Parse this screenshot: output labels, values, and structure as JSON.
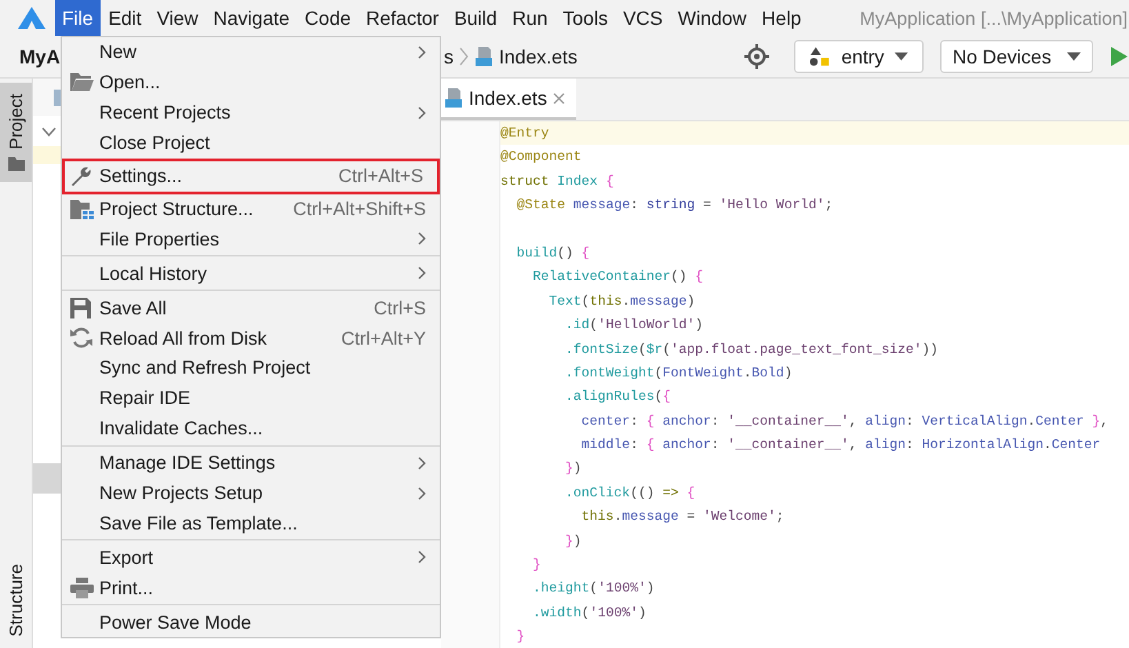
{
  "menubar": {
    "items": [
      {
        "label": "File",
        "selected": true
      },
      {
        "label": "Edit",
        "selected": false
      },
      {
        "label": "View",
        "selected": false
      },
      {
        "label": "Navigate",
        "selected": false
      },
      {
        "label": "Code",
        "selected": false
      },
      {
        "label": "Refactor",
        "selected": false
      },
      {
        "label": "Build",
        "selected": false
      },
      {
        "label": "Run",
        "selected": false
      },
      {
        "label": "Tools",
        "selected": false
      },
      {
        "label": "VCS",
        "selected": false
      },
      {
        "label": "Window",
        "selected": false
      },
      {
        "label": "Help",
        "selected": false
      }
    ],
    "title": "MyApplication [...\\MyApplication]"
  },
  "toolbar": {
    "project": "MyA",
    "breadcrumb": "s",
    "file": "Index.ets",
    "configuration": "entry",
    "device": "No Devices"
  },
  "side_tabs": [
    {
      "label": "Project",
      "selected": true,
      "kind": "top"
    },
    {
      "label": "Structure",
      "selected": false,
      "kind": "bottom"
    }
  ],
  "editor": {
    "tab": {
      "label": "Index.ets",
      "selected": true
    },
    "lines": [
      {
        "kind": "code",
        "current": true,
        "tokens": [
          {
            "text": "@Entry",
            "kind": "ann"
          }
        ]
      },
      {
        "kind": "code",
        "current": false,
        "tokens": [
          {
            "text": "@Component",
            "kind": "ann"
          }
        ]
      },
      {
        "kind": "code",
        "current": false,
        "tokens": [
          {
            "text": "struct ",
            "kind": "kw"
          },
          {
            "text": "Index ",
            "kind": "fn"
          },
          {
            "text": "{",
            "kind": "brace"
          }
        ]
      },
      {
        "kind": "code",
        "current": false,
        "tokens": [
          {
            "text": "  @State",
            "kind": "ann"
          },
          {
            "text": " message",
            "kind": "field"
          },
          {
            "text": ": ",
            "kind": "op"
          },
          {
            "text": "string",
            "kind": "type"
          },
          {
            "text": " = ",
            "kind": "op"
          },
          {
            "text": "'Hello World'",
            "kind": "str"
          },
          {
            "text": ";",
            "kind": "op"
          }
        ]
      },
      {
        "kind": "blank",
        "current": false
      },
      {
        "kind": "code",
        "current": false,
        "tokens": [
          {
            "text": "  build",
            "kind": "fn"
          },
          {
            "text": "() ",
            "kind": "op"
          },
          {
            "text": "{",
            "kind": "brace"
          }
        ]
      },
      {
        "kind": "code",
        "current": false,
        "tokens": [
          {
            "text": "    RelativeContainer",
            "kind": "fn"
          },
          {
            "text": "() ",
            "kind": "op"
          },
          {
            "text": "{",
            "kind": "brace"
          }
        ]
      },
      {
        "kind": "code",
        "current": false,
        "tokens": [
          {
            "text": "      Text",
            "kind": "fn"
          },
          {
            "text": "(",
            "kind": "op"
          },
          {
            "text": "this",
            "kind": "kw"
          },
          {
            "text": ".",
            "kind": "op"
          },
          {
            "text": "message",
            "kind": "field"
          },
          {
            "text": ")",
            "kind": "op"
          }
        ]
      },
      {
        "kind": "code",
        "current": false,
        "tokens": [
          {
            "text": "        .id",
            "kind": "fn"
          },
          {
            "text": "(",
            "kind": "op"
          },
          {
            "text": "'HelloWorld'",
            "kind": "str"
          },
          {
            "text": ")",
            "kind": "op"
          }
        ]
      },
      {
        "kind": "code",
        "current": false,
        "tokens": [
          {
            "text": "        .fontSize",
            "kind": "fn"
          },
          {
            "text": "(",
            "kind": "op"
          },
          {
            "text": "$r",
            "kind": "fn"
          },
          {
            "text": "(",
            "kind": "op"
          },
          {
            "text": "'app.float.page_text_font_size'",
            "kind": "str"
          },
          {
            "text": "))",
            "kind": "op"
          }
        ]
      },
      {
        "kind": "code",
        "current": false,
        "tokens": [
          {
            "text": "        .fontWeight",
            "kind": "fn"
          },
          {
            "text": "(",
            "kind": "op"
          },
          {
            "text": "FontWeight",
            "kind": "field"
          },
          {
            "text": ".",
            "kind": "op"
          },
          {
            "text": "Bold",
            "kind": "field"
          },
          {
            "text": ")",
            "kind": "op"
          }
        ]
      },
      {
        "kind": "code",
        "current": false,
        "tokens": [
          {
            "text": "        .alignRules",
            "kind": "fn"
          },
          {
            "text": "(",
            "kind": "op"
          },
          {
            "text": "{",
            "kind": "brace"
          }
        ]
      },
      {
        "kind": "code",
        "current": false,
        "tokens": [
          {
            "text": "          center",
            "kind": "field"
          },
          {
            "text": ": ",
            "kind": "op"
          },
          {
            "text": "{",
            "kind": "brace"
          },
          {
            "text": " anchor",
            "kind": "field"
          },
          {
            "text": ": ",
            "kind": "op"
          },
          {
            "text": "'__container__'",
            "kind": "str"
          },
          {
            "text": ", ",
            "kind": "op"
          },
          {
            "text": "align",
            "kind": "field"
          },
          {
            "text": ": ",
            "kind": "op"
          },
          {
            "text": "VerticalAlign",
            "kind": "field"
          },
          {
            "text": ".",
            "kind": "op"
          },
          {
            "text": "Center",
            "kind": "field"
          },
          {
            "text": " }",
            "kind": "brace"
          },
          {
            "text": ",",
            "kind": "op"
          }
        ]
      },
      {
        "kind": "code",
        "current": false,
        "tokens": [
          {
            "text": "          middle",
            "kind": "field"
          },
          {
            "text": ": ",
            "kind": "op"
          },
          {
            "text": "{",
            "kind": "brace"
          },
          {
            "text": " anchor",
            "kind": "field"
          },
          {
            "text": ": ",
            "kind": "op"
          },
          {
            "text": "'__container__'",
            "kind": "str"
          },
          {
            "text": ", ",
            "kind": "op"
          },
          {
            "text": "align",
            "kind": "field"
          },
          {
            "text": ": ",
            "kind": "op"
          },
          {
            "text": "HorizontalAlign",
            "kind": "field"
          },
          {
            "text": ".",
            "kind": "op"
          },
          {
            "text": "Center",
            "kind": "field"
          }
        ]
      },
      {
        "kind": "code",
        "current": false,
        "tokens": [
          {
            "text": "        }",
            "kind": "brace"
          },
          {
            "text": ")",
            "kind": "op"
          }
        ]
      },
      {
        "kind": "code",
        "current": false,
        "tokens": [
          {
            "text": "        .onClick",
            "kind": "fn"
          },
          {
            "text": "(() ",
            "kind": "op"
          },
          {
            "text": "=>",
            "kind": "kw"
          },
          {
            "text": " {",
            "kind": "brace"
          }
        ]
      },
      {
        "kind": "code",
        "current": false,
        "tokens": [
          {
            "text": "          this",
            "kind": "kw"
          },
          {
            "text": ".",
            "kind": "op"
          },
          {
            "text": "message",
            "kind": "field"
          },
          {
            "text": " = ",
            "kind": "op"
          },
          {
            "text": "'Welcome'",
            "kind": "str"
          },
          {
            "text": ";",
            "kind": "op"
          }
        ]
      },
      {
        "kind": "code",
        "current": false,
        "tokens": [
          {
            "text": "        }",
            "kind": "brace"
          },
          {
            "text": ")",
            "kind": "op"
          }
        ]
      },
      {
        "kind": "code",
        "current": false,
        "tokens": [
          {
            "text": "    }",
            "kind": "brace"
          }
        ]
      },
      {
        "kind": "code",
        "current": false,
        "tokens": [
          {
            "text": "    .height",
            "kind": "fn"
          },
          {
            "text": "(",
            "kind": "op"
          },
          {
            "text": "'100%'",
            "kind": "str"
          },
          {
            "text": ")",
            "kind": "op"
          }
        ]
      },
      {
        "kind": "code",
        "current": false,
        "tokens": [
          {
            "text": "    .width",
            "kind": "fn"
          },
          {
            "text": "(",
            "kind": "op"
          },
          {
            "text": "'100%'",
            "kind": "str"
          },
          {
            "text": ")",
            "kind": "op"
          }
        ]
      },
      {
        "kind": "code",
        "current": false,
        "tokens": [
          {
            "text": "  }",
            "kind": "brace"
          }
        ]
      }
    ]
  },
  "file_menu": [
    {
      "kind": "item",
      "label": "New",
      "submenu": true,
      "highlighted": false
    },
    {
      "kind": "open",
      "label": "Open...",
      "submenu": false,
      "highlighted": false
    },
    {
      "kind": "item",
      "label": "Recent Projects",
      "submenu": true,
      "highlighted": false
    },
    {
      "kind": "item",
      "label": "Close Project",
      "submenu": false,
      "highlighted": false
    },
    {
      "kind": "settings",
      "label": "Settings...",
      "shortcut": "Ctrl+Alt+S",
      "submenu": false,
      "highlighted": true
    },
    {
      "kind": "structure",
      "label": "Project Structure...",
      "shortcut": "Ctrl+Alt+Shift+S",
      "submenu": false,
      "highlighted": false
    },
    {
      "kind": "item",
      "label": "File Properties",
      "submenu": true,
      "highlighted": false
    },
    {
      "kind": "separator"
    },
    {
      "kind": "item",
      "label": "Local History",
      "submenu": true,
      "highlighted": false
    },
    {
      "kind": "separator"
    },
    {
      "kind": "save",
      "label": "Save All",
      "shortcut": "Ctrl+S",
      "submenu": false,
      "highlighted": false
    },
    {
      "kind": "reload",
      "label": "Reload All from Disk",
      "shortcut": "Ctrl+Alt+Y",
      "submenu": false,
      "highlighted": false
    },
    {
      "kind": "item",
      "label": "Sync and Refresh Project",
      "submenu": false,
      "highlighted": false
    },
    {
      "kind": "item",
      "label": "Repair IDE",
      "submenu": false,
      "highlighted": false
    },
    {
      "kind": "item",
      "label": "Invalidate Caches...",
      "submenu": false,
      "highlighted": false
    },
    {
      "kind": "separator"
    },
    {
      "kind": "item",
      "label": "Manage IDE Settings",
      "submenu": true,
      "highlighted": false
    },
    {
      "kind": "item",
      "label": "New Projects Setup",
      "submenu": true,
      "highlighted": false
    },
    {
      "kind": "item",
      "label": "Save File as Template...",
      "submenu": false,
      "highlighted": false
    },
    {
      "kind": "separator"
    },
    {
      "kind": "item",
      "label": "Export",
      "submenu": true,
      "highlighted": false
    },
    {
      "kind": "print",
      "label": "Print...",
      "submenu": false,
      "highlighted": false
    },
    {
      "kind": "separator"
    },
    {
      "kind": "item",
      "label": "Power Save Mode",
      "submenu": false,
      "highlighted": false
    }
  ]
}
